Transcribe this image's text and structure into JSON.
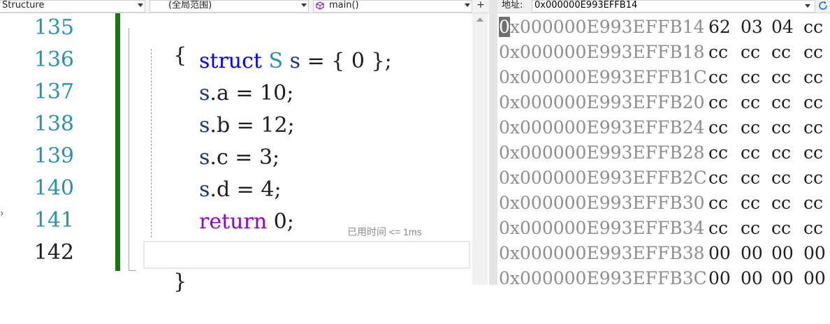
{
  "nav": {
    "project_combo": "Structure",
    "scope_combo": "(全局范围)",
    "function_combo": "main()",
    "split_button": "+"
  },
  "editor": {
    "line_numbers": [
      "135",
      "136",
      "137",
      "138",
      "139",
      "140",
      "141",
      "142"
    ],
    "current_line": "142",
    "lines": {
      "l135": {
        "brace": "{"
      },
      "l136": {
        "kw": "struct",
        "type": "S",
        "var": "s",
        "rest": " = { 0 };"
      },
      "l137": {
        "var": "s",
        "rest": ".a = 10;"
      },
      "l138": {
        "var": "s",
        "rest": ".b = 12;"
      },
      "l139": {
        "var": "s",
        "rest": ".c = 3;"
      },
      "l140": {
        "var": "s",
        "rest": ".d = 4;"
      },
      "l141": {
        "kw": "return",
        "rest": " 0;",
        "hint": "已用时间 <= 1ms"
      },
      "l142": {
        "brace": "}"
      }
    }
  },
  "memory": {
    "address_label": "地址:",
    "address_value": "0x000000E993EFFB14",
    "rows": [
      {
        "addr_first": "0",
        "addr_rest": "x000000E993EFFB14",
        "bytes": [
          "62",
          "03",
          "04",
          "cc"
        ]
      },
      {
        "addr_first": "",
        "addr_rest": "0x000000E993EFFB18",
        "bytes": [
          "cc",
          "cc",
          "cc",
          "cc"
        ]
      },
      {
        "addr_first": "",
        "addr_rest": "0x000000E993EFFB1C",
        "bytes": [
          "cc",
          "cc",
          "cc",
          "cc"
        ]
      },
      {
        "addr_first": "",
        "addr_rest": "0x000000E993EFFB20",
        "bytes": [
          "cc",
          "cc",
          "cc",
          "cc"
        ]
      },
      {
        "addr_first": "",
        "addr_rest": "0x000000E993EFFB24",
        "bytes": [
          "cc",
          "cc",
          "cc",
          "cc"
        ]
      },
      {
        "addr_first": "",
        "addr_rest": "0x000000E993EFFB28",
        "bytes": [
          "cc",
          "cc",
          "cc",
          "cc"
        ]
      },
      {
        "addr_first": "",
        "addr_rest": "0x000000E993EFFB2C",
        "bytes": [
          "cc",
          "cc",
          "cc",
          "cc"
        ]
      },
      {
        "addr_first": "",
        "addr_rest": "0x000000E993EFFB30",
        "bytes": [
          "cc",
          "cc",
          "cc",
          "cc"
        ]
      },
      {
        "addr_first": "",
        "addr_rest": "0x000000E993EFFB34",
        "bytes": [
          "cc",
          "cc",
          "cc",
          "cc"
        ]
      },
      {
        "addr_first": "",
        "addr_rest": "0x000000E993EFFB38",
        "bytes": [
          "00",
          "00",
          "00",
          "00"
        ]
      },
      {
        "addr_first": "",
        "addr_rest": "0x000000E993EFFB3C",
        "bytes": [
          "00",
          "00",
          "00",
          "00"
        ]
      }
    ]
  },
  "colors": {
    "keyword": "#0000ff",
    "control_keyword": "#8f08c4",
    "type": "#2b91af",
    "variable": "#1f377f",
    "line_number": "#2b91af",
    "change_bar": "#107c10",
    "address_gray": "#8e8e8e"
  }
}
